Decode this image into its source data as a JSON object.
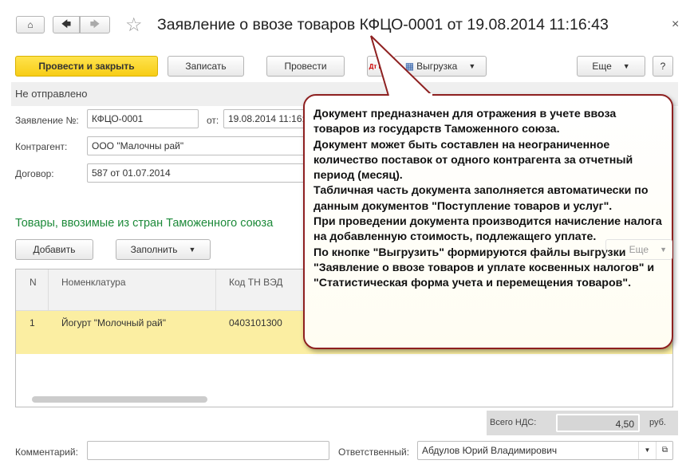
{
  "header": {
    "title": "Заявление о ввозе товаров КФЦО-0001 от 19.08.2014 11:16:43",
    "close": "×",
    "home_icon": "home-icon",
    "back_icon": "arrow-left-icon",
    "forward_icon": "arrow-right-icon",
    "star_icon": "star-icon"
  },
  "toolbar": {
    "post_close": "Провести и закрыть",
    "save": "Записать",
    "post": "Провести",
    "dtkt": "Дт Кт",
    "export": "Выгрузка",
    "more": "Еще",
    "help": "?"
  },
  "status": "Не отправлено",
  "form": {
    "number_label": "Заявление №:",
    "number": "КФЦО-0001",
    "date_label": "от:",
    "date": "19.08.2014 11:16:43",
    "contractor_label": "Контрагент:",
    "contractor": "ООО \"Малочны рай\"",
    "contract_label": "Договор:",
    "contract": "587 от 01.07.2014"
  },
  "goods": {
    "section_title": "Товары, ввозимые из стран Таможенного союза",
    "add": "Добавить",
    "fill": "Заполнить",
    "more": "Еще",
    "columns": [
      "N",
      "Номенклатура",
      "Код ТН ВЭД"
    ],
    "rows": [
      {
        "n": "1",
        "name": "Йогурт \"Молочный рай\"",
        "code": "0403101300"
      }
    ]
  },
  "totals": {
    "vat_label": "Всего НДС:",
    "vat": "4,50",
    "currency": "руб."
  },
  "footer": {
    "comment_label": "Комментарий:",
    "comment": "",
    "responsible_label": "Ответственный:",
    "responsible": "Абдулов Юрий Владимирович"
  },
  "callout": {
    "lines": [
      "Документ предназначен для отражения в учете ввоза товаров из государств Таможенного союза.",
      "Документ может быть составлен на неограниченное количество поставок от одного контрагента за отчетный период (месяц).",
      "Табличная часть документа заполняется автоматически по данным документов \"Поступление товаров и услуг\".",
      "При проведении документа производится начисление налога на добавленную стоимость, подлежащего уплате.",
      "По кнопке \"Выгрузить\" формируются файлы выгрузки \"Заявление о ввозе товаров и уплате косвенных налогов\" и \"Статистическая форма учета и перемещения товаров\"."
    ]
  },
  "colors": {
    "accent": "#f7cd16",
    "section_title": "#1d8a3a",
    "row_selected": "#fbeea2",
    "callout_border": "#8e2020"
  }
}
